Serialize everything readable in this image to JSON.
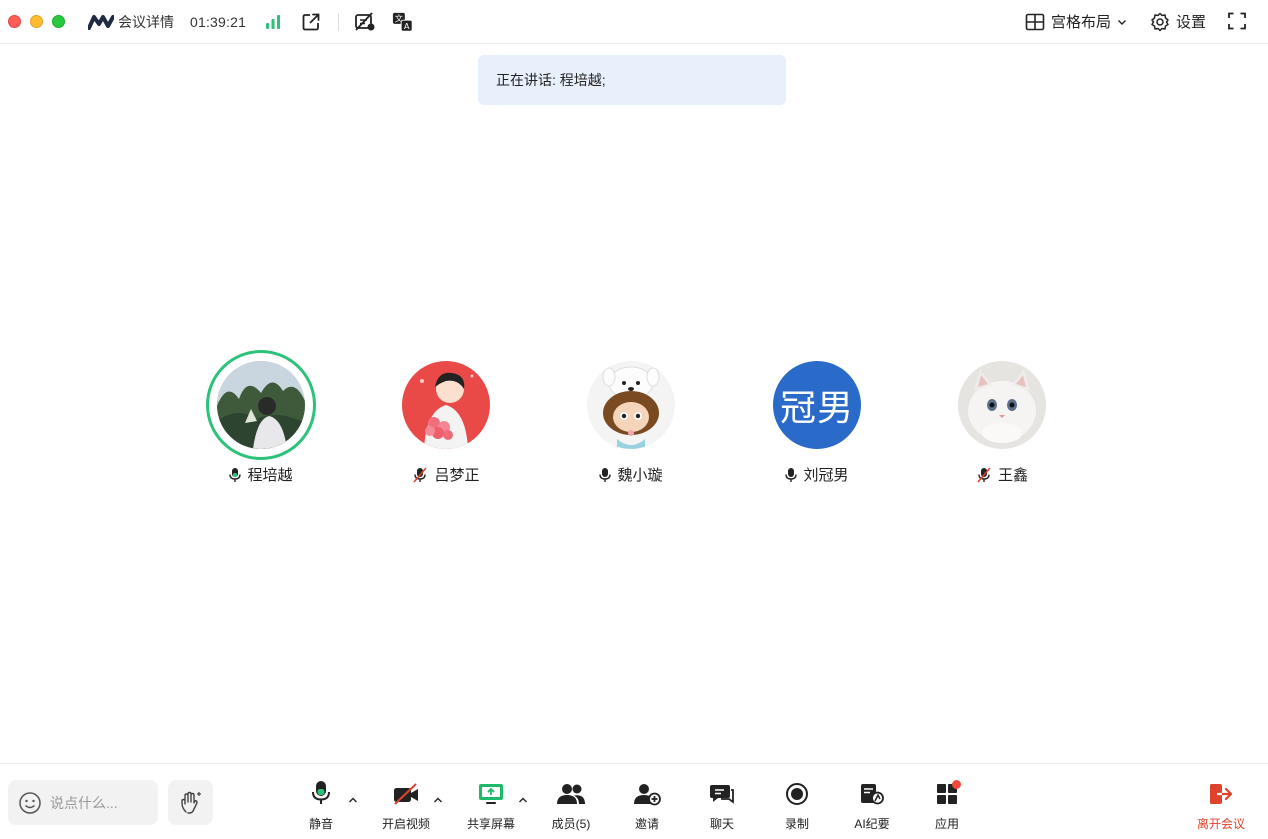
{
  "titlebar": {
    "app_name": "会议详情",
    "timer": "01:39:21",
    "layout_label": "宫格布局",
    "settings_label": "设置"
  },
  "banner": {
    "speaking_text": "正在讲话: 程培越;"
  },
  "participants": [
    {
      "name": "程培越",
      "mic": "on",
      "speaking": true,
      "avatar": "photo-person"
    },
    {
      "name": "吕梦正",
      "mic": "muted",
      "speaking": false,
      "avatar": "illustration-girl-flowers"
    },
    {
      "name": "魏小璇",
      "mic": "on",
      "speaking": false,
      "avatar": "doll-character"
    },
    {
      "name": "刘冠男",
      "mic": "on",
      "speaking": false,
      "avatar": "text",
      "avatar_text": "冠男"
    },
    {
      "name": "王鑫",
      "mic": "muted",
      "speaking": false,
      "avatar": "photo-cat"
    }
  ],
  "bottombar": {
    "chat_placeholder": "说点什么...",
    "tools": {
      "mute": "静音",
      "video": "开启视频",
      "share": "共享屏幕",
      "members": "成员(5)",
      "invite": "邀请",
      "chat": "聊天",
      "record": "录制",
      "ai_summary": "AI纪要",
      "apps": "应用",
      "leave": "离开会议"
    }
  },
  "colors": {
    "accent_green": "#2bc27a",
    "leave_red": "#e0432b",
    "banner_bg": "#e8f0fc",
    "avatar_blue": "#2a6ac9",
    "share_green": "#1fb96a"
  }
}
